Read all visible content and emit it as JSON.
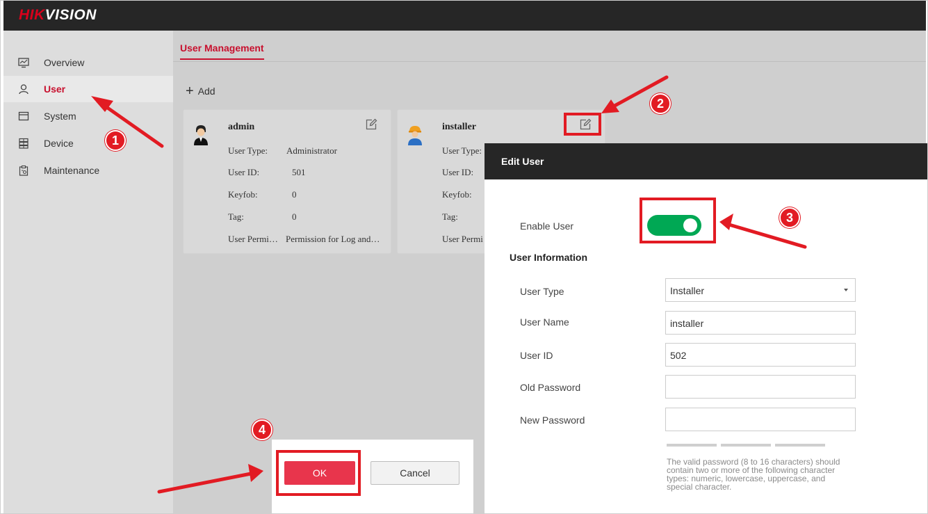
{
  "brand": {
    "part1": "HIK",
    "part2": "VISION"
  },
  "sidebar": {
    "items": [
      {
        "label": "Overview",
        "icon": "monitor-icon"
      },
      {
        "label": "User",
        "icon": "user-icon"
      },
      {
        "label": "System",
        "icon": "system-icon"
      },
      {
        "label": "Device",
        "icon": "device-icon"
      },
      {
        "label": "Maintenance",
        "icon": "maintenance-icon"
      }
    ],
    "active": "User"
  },
  "main": {
    "tab": "User Management",
    "add_label": "Add",
    "cards": [
      {
        "name": "admin",
        "rows": [
          {
            "label": "User Type:",
            "value": "Administrator"
          },
          {
            "label": "User ID:",
            "value": "501"
          },
          {
            "label": "Keyfob:",
            "value": "0"
          },
          {
            "label": "Tag:",
            "value": "0"
          },
          {
            "label": "User Permi…",
            "value": "Permission for Log and…"
          }
        ]
      },
      {
        "name": "installer",
        "rows": [
          {
            "label": "User Type:"
          },
          {
            "label": "User ID:"
          },
          {
            "label": "Keyfob:"
          },
          {
            "label": "Tag:"
          },
          {
            "label": "User Permi"
          }
        ]
      }
    ]
  },
  "dialog": {
    "title": "Edit User",
    "enable_label": "Enable User",
    "enable_on": true,
    "section": "User Information",
    "fields": {
      "user_type": {
        "label": "User Type",
        "value": "Installer"
      },
      "user_name": {
        "label": "User Name",
        "value": "installer"
      },
      "user_id": {
        "label": "User ID",
        "value": "502"
      },
      "old_password": {
        "label": "Old Password",
        "value": ""
      },
      "new_password": {
        "label": "New Password",
        "value": ""
      }
    },
    "hint": "The valid password (8 to 16 characters) should contain two or more of the following character types: numeric, lowercase, uppercase, and special character."
  },
  "buttons": {
    "ok": "OK",
    "cancel": "Cancel"
  },
  "annotations": {
    "steps": [
      "1",
      "2",
      "3",
      "4"
    ],
    "color": "#e21b23"
  },
  "colors": {
    "accent": "#c8102e",
    "toggle_on": "#00a854",
    "ok_button": "#e8354c"
  }
}
